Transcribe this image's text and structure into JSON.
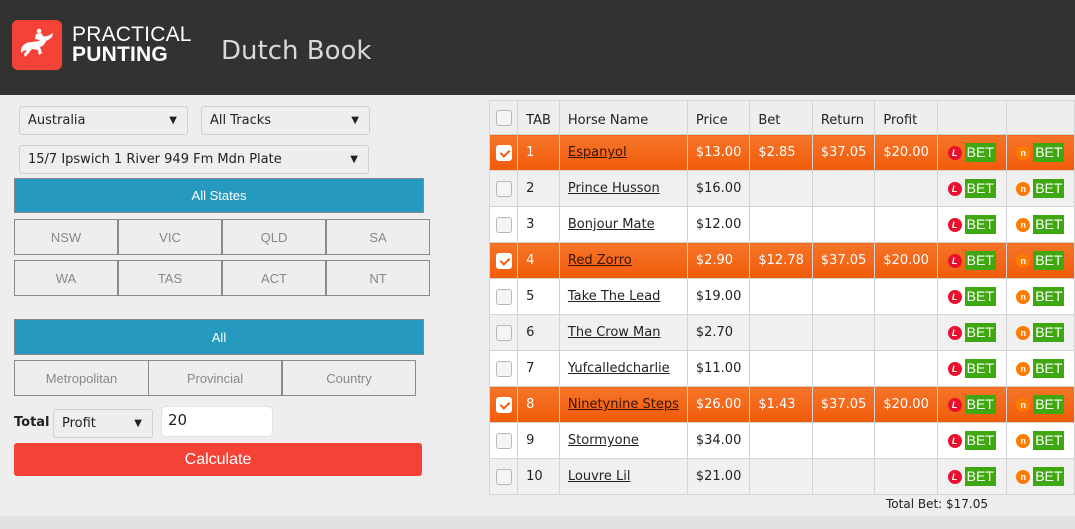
{
  "header": {
    "brand_line1": "PRACTICAL",
    "brand_line2": "PUNTING",
    "logo_icon": "horse-jockey-icon",
    "title": "Dutch Book",
    "colors": {
      "bar": "#323232",
      "logo": "#f44336"
    }
  },
  "filters": {
    "country": "Australia",
    "tracks": "All Tracks",
    "race": "15/7 Ipswich 1 River 949 Fm Mdn Plate",
    "all_states_label": "All States",
    "states": [
      "NSW",
      "VIC",
      "QLD",
      "SA",
      "WA",
      "TAS",
      "ACT",
      "NT"
    ],
    "all_types_label": "All",
    "types": [
      "Metropolitan",
      "Provincial",
      "Country"
    ],
    "active_color": "#2699be"
  },
  "calc": {
    "total_label": "Total",
    "mode": "Profit",
    "amount": "20",
    "calculate_label": "Calculate",
    "button_color": "#f44336"
  },
  "table": {
    "headers": [
      "",
      "TAB",
      "Horse Name",
      "Price",
      "Bet",
      "Return",
      "Profit",
      "",
      ""
    ],
    "bookie1_icon": "ladbrokes-icon",
    "bookie2_icon": "neds-icon",
    "bookie1_glyph": "L",
    "bookie2_glyph": "n",
    "bet_label": "BET",
    "selected_color": "#f25b0a",
    "rows": [
      {
        "checked": true,
        "tab": "1",
        "name": "Espanyol",
        "price": "$13.00",
        "bet": "$2.85",
        "return": "$37.05",
        "profit": "$20.00"
      },
      {
        "checked": false,
        "tab": "2",
        "name": "Prince Husson",
        "price": "$16.00",
        "bet": "",
        "return": "",
        "profit": ""
      },
      {
        "checked": false,
        "tab": "3",
        "name": "Bonjour Mate",
        "price": "$12.00",
        "bet": "",
        "return": "",
        "profit": ""
      },
      {
        "checked": true,
        "tab": "4",
        "name": "Red Zorro",
        "price": "$2.90",
        "bet": "$12.78",
        "return": "$37.05",
        "profit": "$20.00"
      },
      {
        "checked": false,
        "tab": "5",
        "name": "Take The Lead",
        "price": "$19.00",
        "bet": "",
        "return": "",
        "profit": ""
      },
      {
        "checked": false,
        "tab": "6",
        "name": "The Crow Man",
        "price": "$2.70",
        "bet": "",
        "return": "",
        "profit": ""
      },
      {
        "checked": false,
        "tab": "7",
        "name": "Yufcalledcharlie",
        "price": "$11.00",
        "bet": "",
        "return": "",
        "profit": ""
      },
      {
        "checked": true,
        "tab": "8",
        "name": "Ninetynine Steps",
        "price": "$26.00",
        "bet": "$1.43",
        "return": "$37.05",
        "profit": "$20.00"
      },
      {
        "checked": false,
        "tab": "9",
        "name": "Stormyone",
        "price": "$34.00",
        "bet": "",
        "return": "",
        "profit": ""
      },
      {
        "checked": false,
        "tab": "10",
        "name": "Louvre Lil",
        "price": "$21.00",
        "bet": "",
        "return": "",
        "profit": ""
      }
    ],
    "total_bet": "Total Bet: $17.05"
  }
}
